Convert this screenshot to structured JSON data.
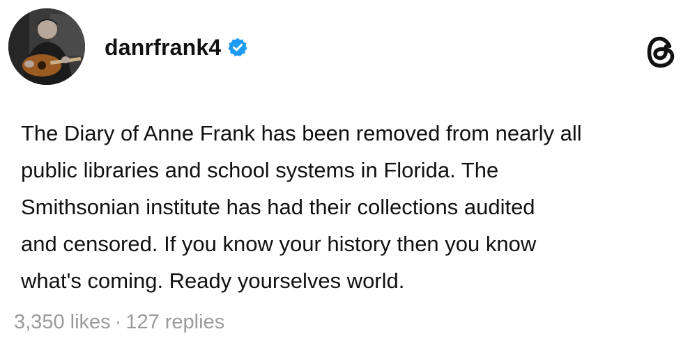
{
  "post": {
    "username": "danrfrank4",
    "body_lines": [
      "The Diary of Anne Frank has been removed from nearly all",
      "public libraries and school systems in Florida. The",
      "Smithsonian institute has had their collections audited",
      "and censored. If you know your history then you know",
      "what's coming. Ready yourselves world."
    ],
    "likes": "3,350 likes",
    "separator": "·",
    "replies": "127 replies"
  },
  "icons": {
    "avatar": "avatar-photo",
    "verified": "verified-badge-icon",
    "app": "threads-logo-icon"
  },
  "colors": {
    "verified_blue": "#1d9bf0",
    "meta_gray": "#9a9a9a",
    "text": "#111111",
    "background": "#ffffff"
  }
}
